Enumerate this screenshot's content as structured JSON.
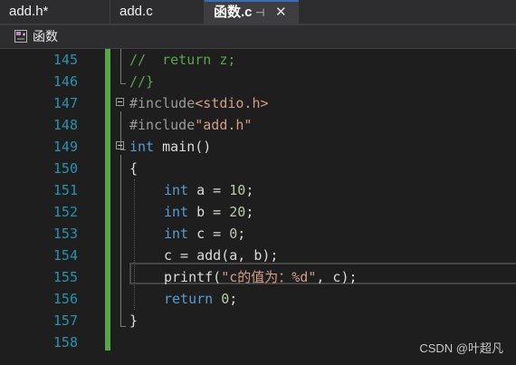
{
  "tabs": [
    {
      "label": "add.h*"
    },
    {
      "label": "add.c"
    },
    {
      "label": "函数.c",
      "pin_icon": "pin-icon",
      "close_icon": "close-icon"
    }
  ],
  "nav": {
    "icon": "function-scope-icon",
    "label": "函数"
  },
  "editor": {
    "lines": [
      {
        "num": "145",
        "code": "//  return z;"
      },
      {
        "num": "146",
        "code": "//}"
      },
      {
        "num": "147",
        "code": "#include<stdio.h>"
      },
      {
        "num": "148",
        "code": "#include\"add.h\""
      },
      {
        "num": "149",
        "code": "int main()"
      },
      {
        "num": "150",
        "code": "{"
      },
      {
        "num": "151",
        "code": "int a = 10;"
      },
      {
        "num": "152",
        "code": "int b = 20;"
      },
      {
        "num": "153",
        "code": "int c = 0;"
      },
      {
        "num": "154",
        "code": "c = add(a, b);"
      },
      {
        "num": "155",
        "code": "printf(\"c的值为：%d\", c);"
      },
      {
        "num": "156",
        "code": "return 0;"
      },
      {
        "num": "157",
        "code": "}"
      },
      {
        "num": "158",
        "code": ""
      }
    ]
  },
  "colors": {
    "line_number": "#2b91af",
    "comment": "#57a64a",
    "keyword": "#569cd6",
    "string": "#d69d85",
    "number": "#b5cea8",
    "change_bar": "#57a64a"
  },
  "watermark": "CSDN @叶超凡"
}
